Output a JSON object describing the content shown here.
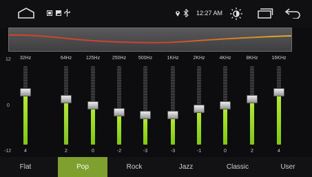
{
  "status": {
    "time": "12:27 AM"
  },
  "eq": {
    "db_top": "12",
    "db_mid": "0",
    "db_bottom": "-12",
    "bands": [
      {
        "freq": "32Hz",
        "gain": "4"
      },
      {
        "freq": "64Hz",
        "gain": "2"
      },
      {
        "freq": "125Hz",
        "gain": "0"
      },
      {
        "freq": "250Hz",
        "gain": "-2"
      },
      {
        "freq": "500Hz",
        "gain": "-3"
      },
      {
        "freq": "1KHz",
        "gain": "-3"
      },
      {
        "freq": "2KHz",
        "gain": "-1"
      },
      {
        "freq": "4KHz",
        "gain": "0"
      },
      {
        "freq": "8KHz",
        "gain": "2"
      },
      {
        "freq": "16KHz",
        "gain": "4"
      }
    ]
  },
  "presets": [
    "Flat",
    "Pop",
    "Rock",
    "Jazz",
    "Classic",
    "User"
  ],
  "selected_preset": "Pop",
  "colors": {
    "accent": "#7f9f2e",
    "slider_fill": "#a6e31f",
    "curve_red": "#d4432a",
    "curve_yellow": "#e0b31f"
  }
}
